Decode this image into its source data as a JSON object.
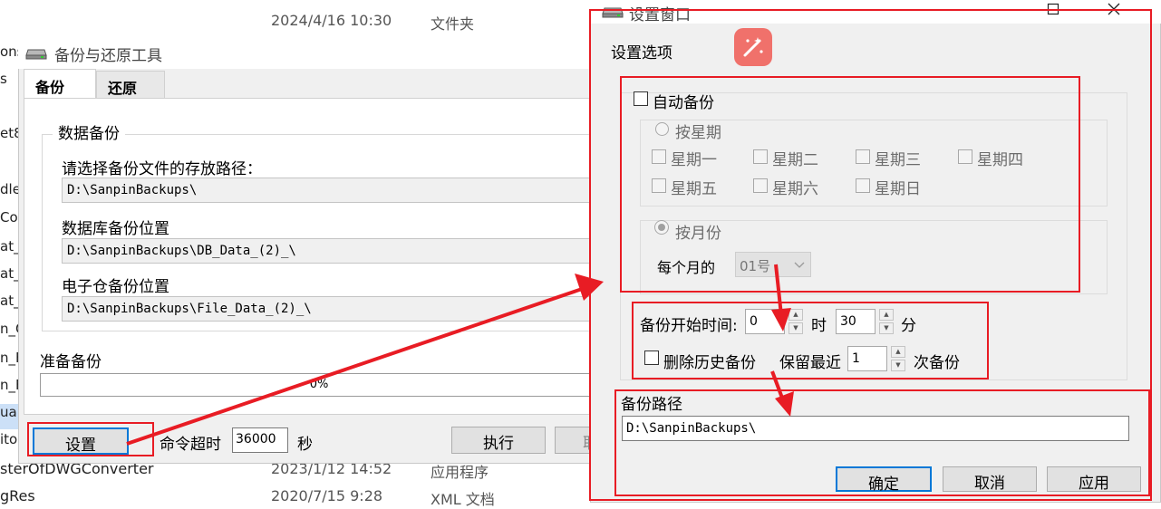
{
  "explorer": {
    "left_names": [
      "ons",
      "s",
      "et8.",
      "dle",
      "Co",
      "at_C",
      "at_F",
      "at_F",
      "n_C",
      "n_F",
      "n_F",
      "ual",
      "ito"
    ],
    "rows": [
      {
        "name": "",
        "date": "2024/4/16 10:30",
        "type": "文件夹"
      },
      {
        "name": "sterOfDWGConverter",
        "date": "2023/1/12 14:52",
        "type": "应用程序"
      },
      {
        "name": "gRes",
        "date": "2020/7/15 9:28",
        "type": "XML 文档"
      }
    ]
  },
  "backup_tool": {
    "title": "备份与还原工具",
    "tabs": [
      "备份",
      "还原"
    ],
    "group_title": "数据备份",
    "path_label": "请选择备份文件的存放路径：",
    "path_value": "D:\\SanpinBackups\\",
    "db_label": "数据库备份位置",
    "db_value": "D:\\SanpinBackups\\DB_Data_(2)_\\",
    "file_label": "电子仓备份位置",
    "file_value": "D:\\SanpinBackups\\File_Data_(2)_\\",
    "status": "准备备份",
    "progress_text": "0%",
    "progress": 0,
    "settings_button": "设置",
    "timeout_label": "命令超时",
    "timeout_value": "36000",
    "timeout_unit": "秒",
    "execute_button": "执行",
    "cancel_partial": "取"
  },
  "settings": {
    "title": "设置窗口",
    "section_title": "设置选项",
    "auto_backup": "自动备份",
    "by_week": "按星期",
    "weekdays": [
      "星期一",
      "星期二",
      "星期三",
      "星期四",
      "星期五",
      "星期六",
      "星期日"
    ],
    "by_month": "按月份",
    "monthly_label": "每个月的",
    "monthly_value": "01号",
    "start_time_label": "备份开始时间:",
    "hour_value": "0",
    "hour_unit": "时",
    "minute_value": "30",
    "minute_unit": "分",
    "delete_history": "删除历史备份",
    "keep_recent": "保留最近",
    "keep_value": "1",
    "keep_unit": "次备份",
    "path_title": "备份路径",
    "path_value": "D:\\SanpinBackups\\",
    "ok": "确定",
    "cancel": "取消",
    "apply": "应用"
  },
  "colors": {
    "annotation_red": "#e81c24",
    "focus_blue": "#0078d7",
    "ai_badge": "#f0716b"
  }
}
